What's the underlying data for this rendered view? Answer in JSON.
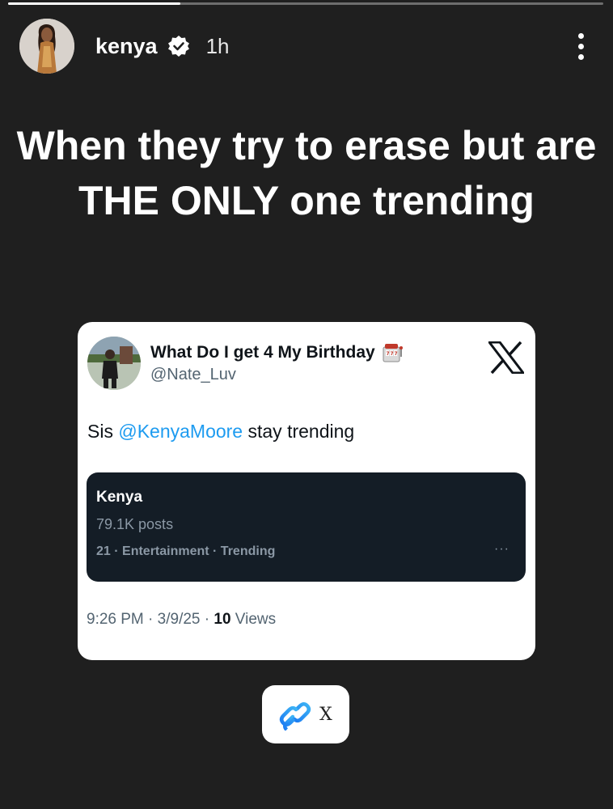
{
  "story": {
    "progress": 0.29,
    "username": "kenya",
    "time_ago": "1h",
    "caption": "When they try to erase but are THE ONLY one trending"
  },
  "icons": {
    "verified": "verified-badge-icon",
    "more": "more-vertical-icon",
    "x": "x-logo-icon",
    "link": "link-icon"
  },
  "tweet": {
    "display_name": "What Do I get 4 My Birthday",
    "handle": "@Nate_Luv",
    "text_prefix": "Sis",
    "mention": "@KenyaMoore",
    "text_suffix": "stay trending",
    "trend": {
      "title": "Kenya",
      "posts": "79.1K posts",
      "category": "21 · Entertainment · Trending",
      "more": "···"
    },
    "time": "9:26 PM",
    "date": "3/9/25",
    "views_count": "10",
    "views_label": "Views"
  },
  "link_sticker": {
    "label": "X"
  },
  "colors": {
    "background": "#1f1f1f",
    "mention": "#1d9bf0",
    "trend_card": "#141d26",
    "secondary_text": "#536471"
  }
}
